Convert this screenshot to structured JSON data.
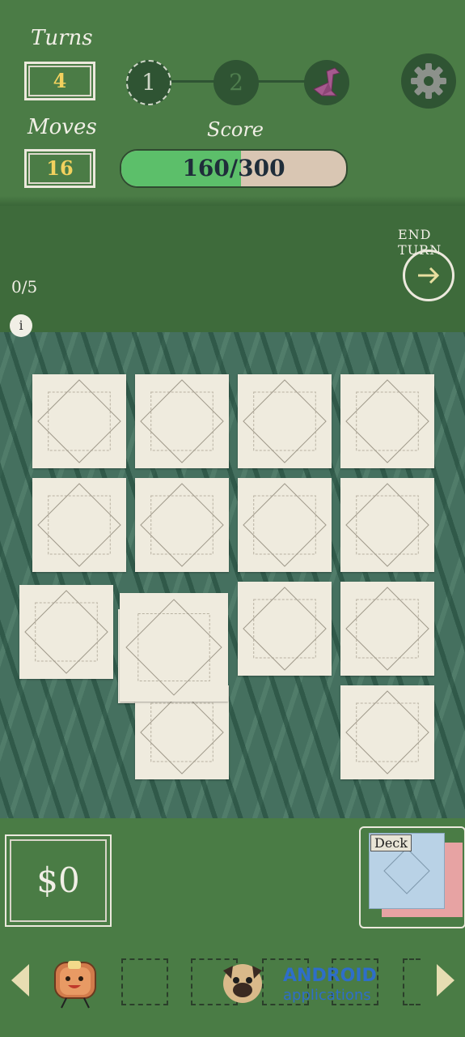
{
  "hud": {
    "turns_label": "Turns",
    "turns_value": "4",
    "moves_label": "Moves",
    "moves_value": "16",
    "score_label": "Score",
    "score_text": "160/300",
    "score_progress": 0.533,
    "stages": [
      "1",
      "2"
    ],
    "final_stage_icon": "origami-bird-icon",
    "settings_icon": "gear-icon"
  },
  "turn": {
    "end_turn_label": "END TURN",
    "counter": "0/5",
    "info_label": "i"
  },
  "board": {
    "tile_count": 15
  },
  "bottom": {
    "money": "$0",
    "deck_label": "Deck",
    "watermark_line1": "ANDROID",
    "watermark_line2": "applications"
  },
  "colors": {
    "hud_green": "#4b7c46",
    "band_green": "#3e6b3b",
    "board_bg": "#45705f",
    "tile": "#efebde",
    "score_fill": "#5cbf6a",
    "score_track": "#d9c6b3",
    "value_yellow": "#f2d15e"
  }
}
